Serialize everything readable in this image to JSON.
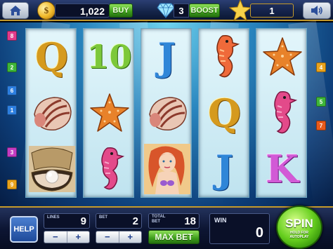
{
  "topbar": {
    "coin_symbol": "$",
    "coins": "1,022",
    "buy_label": "BUY",
    "boost_count": "3",
    "boost_label": "BOOST",
    "level": "1"
  },
  "reels": [
    [
      "Q",
      "shell",
      "pearl-oyster"
    ],
    [
      "10",
      "starfish",
      "seahorse"
    ],
    [
      "J",
      "shell",
      "mermaid"
    ],
    [
      "seahorse",
      "Q",
      "J"
    ],
    [
      "starfish",
      "seahorse",
      "K"
    ]
  ],
  "paylines": {
    "left": [
      "8",
      "2",
      "6",
      "1",
      "3",
      "9"
    ],
    "right": [
      "4",
      "5",
      "7"
    ]
  },
  "bottombar": {
    "help_label": "HELP",
    "lines_label": "LINES",
    "lines_value": "9",
    "bet_label": "BET",
    "bet_value": "2",
    "total_bet_label_1": "TOTAL",
    "total_bet_label_2": "BET",
    "total_bet_value": "18",
    "minus": "−",
    "plus": "+",
    "max_bet_label": "MAX BET",
    "win_label": "WIN",
    "win_value": "0",
    "spin_label": "SPIN",
    "spin_sub_1": "HOLD FOR",
    "spin_sub_2": "AUTOPLAY"
  },
  "colors": {
    "payline_colors": [
      "#e23b8c",
      "#3fb63a",
      "#2d7fe0",
      "#e8a21c",
      "#7d3fd3",
      "#e85a1c",
      "#1fb5b0",
      "#c83232",
      "#d6c51c"
    ],
    "accent_green": "#3c9c1b",
    "gold_trim": "#c59a2a"
  }
}
